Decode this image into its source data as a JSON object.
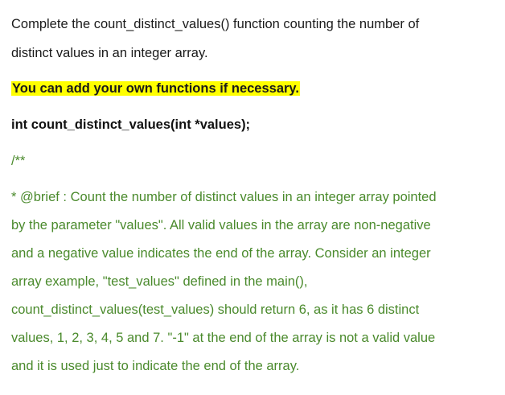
{
  "document": {
    "intro_lines": [
      "Complete the count_distinct_values() function counting the number of",
      "distinct values in an integer array."
    ],
    "highlight_text": "You can add your own functions if necessary.",
    "signature": "int count_distinct_values(int *values);",
    "comment_open": "/**",
    "comment_lines": [
      "* @brief : Count the number of distinct values in an integer array pointed",
      "by the parameter \"values\". All valid values in the array are non-negative",
      "and a negative value indicates the end of the array. Consider an integer",
      "array example, \"test_values\" defined in the main(),",
      "count_distinct_values(test_values) should return 6, as it has 6 distinct",
      "values, 1, 2, 3, 4, 5 and 7. \"-1\" at the end of the array is not a valid value",
      "and it is used just to indicate the end of the array."
    ]
  },
  "colors": {
    "comment_green": "#4a8a2c",
    "highlight_yellow": "#ffff00"
  }
}
